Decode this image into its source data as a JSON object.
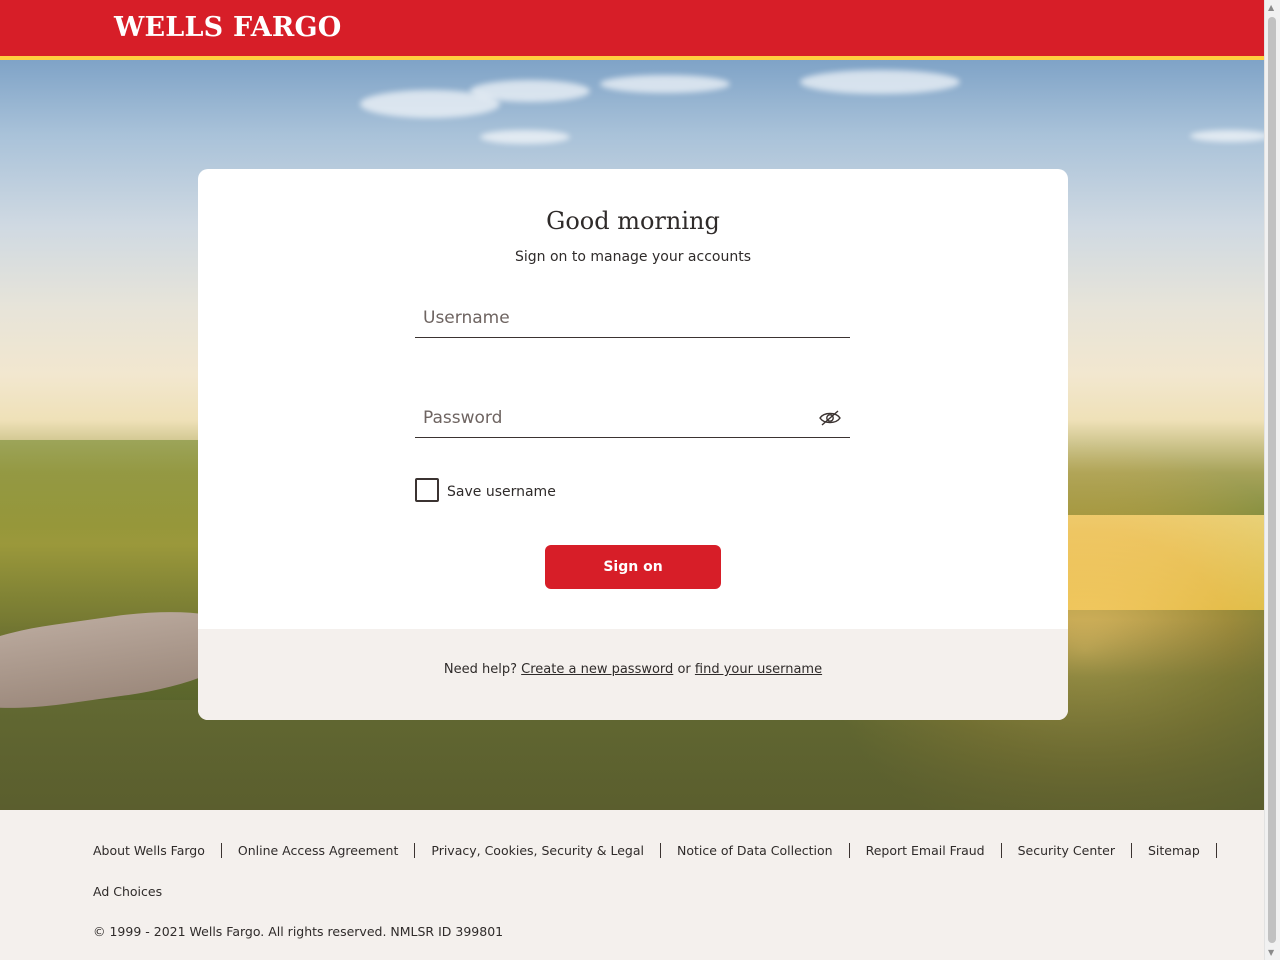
{
  "header": {
    "logo_text": "WELLS FARGO"
  },
  "login": {
    "greeting": "Good morning",
    "subtitle": "Sign on to manage your accounts",
    "username_placeholder": "Username",
    "password_placeholder": "Password",
    "save_username_label": "Save username",
    "sign_on_label": "Sign on",
    "help_prefix": "Need help?",
    "create_password_link": "Create a new password",
    "help_or": "or",
    "find_username_link": "find your username"
  },
  "footer": {
    "links": [
      "About Wells Fargo",
      "Online Access Agreement",
      "Privacy, Cookies, Security & Legal",
      "Notice of Data Collection",
      "Report Email Fraud",
      "Security Center",
      "Sitemap"
    ],
    "ad_choices": "Ad Choices",
    "copyright": "© 1999 - 2021 Wells Fargo. All rights reserved. NMLSR ID 399801"
  },
  "colors": {
    "brand_red": "#d71e28",
    "brand_gold": "#ffcd41"
  },
  "icons": {
    "password_toggle": "eye-slash-icon"
  }
}
